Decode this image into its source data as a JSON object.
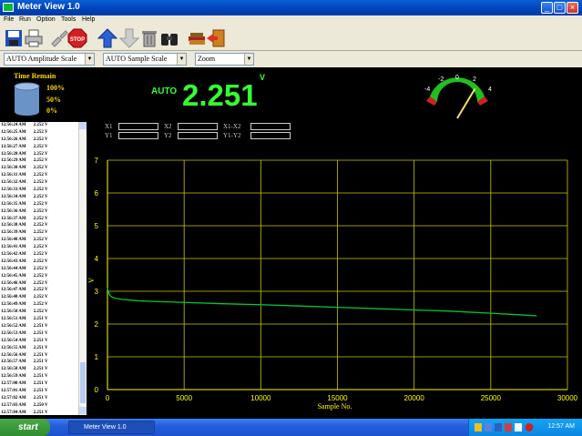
{
  "window": {
    "title": "Meter View 1.0",
    "buttons": {
      "minimize": "_",
      "maximize": "□",
      "close": "×"
    }
  },
  "menu": [
    "File",
    "Run",
    "Option",
    "Tools",
    "Help"
  ],
  "toolbar": {
    "buttons": [
      "save-icon",
      "print-icon",
      "disconnect-icon",
      "stop-icon",
      "arrow-up-icon",
      "arrow-down-icon",
      "trash-icon",
      "binoculars-icon",
      "books-icon",
      "exit-icon"
    ],
    "stop_label": "STOP"
  },
  "options": {
    "amplitude_scale": "AUTO Amplitude Scale",
    "sample_scale": "AUTO Sample Scale",
    "zoom": "Zoom"
  },
  "time_remain": {
    "label": "Time Remain",
    "levels": [
      "100%",
      "50%",
      "0%"
    ]
  },
  "meter": {
    "mode": "AUTO",
    "value": "2.251",
    "unit": "V",
    "gauge_ticks": [
      "-4",
      "-2",
      "0",
      "2",
      "4"
    ],
    "gauge_needle_value": 2.251
  },
  "cursors": {
    "labels": [
      "X1",
      "Y1",
      "X2",
      "Y2",
      "X1-X2",
      "Y1-Y2"
    ]
  },
  "log": [
    [
      "12:56:24 AM",
      "2.252 V"
    ],
    [
      "12:56:25 AM",
      "2.252 V"
    ],
    [
      "12:56:26 AM",
      "2.252 V"
    ],
    [
      "12:56:27 AM",
      "2.252 V"
    ],
    [
      "12:56:28 AM",
      "2.252 V"
    ],
    [
      "12:56:29 AM",
      "2.252 V"
    ],
    [
      "12:56:30 AM",
      "2.252 V"
    ],
    [
      "12:56:31 AM",
      "2.252 V"
    ],
    [
      "12:56:32 AM",
      "2.252 V"
    ],
    [
      "12:56:33 AM",
      "2.252 V"
    ],
    [
      "12:56:34 AM",
      "2.252 V"
    ],
    [
      "12:56:35 AM",
      "2.252 V"
    ],
    [
      "12:56:36 AM",
      "2.252 V"
    ],
    [
      "12:56:37 AM",
      "2.252 V"
    ],
    [
      "12:56:38 AM",
      "2.252 V"
    ],
    [
      "12:56:39 AM",
      "2.252 V"
    ],
    [
      "12:56:40 AM",
      "2.252 V"
    ],
    [
      "12:56:41 AM",
      "2.252 V"
    ],
    [
      "12:56:42 AM",
      "2.252 V"
    ],
    [
      "12:56:43 AM",
      "2.252 V"
    ],
    [
      "12:56:44 AM",
      "2.252 V"
    ],
    [
      "12:56:45 AM",
      "2.252 V"
    ],
    [
      "12:56:46 AM",
      "2.252 V"
    ],
    [
      "12:56:47 AM",
      "2.252 V"
    ],
    [
      "12:56:48 AM",
      "2.252 V"
    ],
    [
      "12:56:49 AM",
      "2.252 V"
    ],
    [
      "12:56:50 AM",
      "2.252 V"
    ],
    [
      "12:56:51 AM",
      "2.251 V"
    ],
    [
      "12:56:52 AM",
      "2.251 V"
    ],
    [
      "12:56:53 AM",
      "2.251 V"
    ],
    [
      "12:56:54 AM",
      "2.251 V"
    ],
    [
      "12:56:55 AM",
      "2.251 V"
    ],
    [
      "12:56:56 AM",
      "2.251 V"
    ],
    [
      "12:56:57 AM",
      "2.251 V"
    ],
    [
      "12:56:58 AM",
      "2.251 V"
    ],
    [
      "12:56:59 AM",
      "2.251 V"
    ],
    [
      "12:57:00 AM",
      "2.251 V"
    ],
    [
      "12:57:01 AM",
      "2.251 V"
    ],
    [
      "12:57:02 AM",
      "2.251 V"
    ],
    [
      "12:57:03 AM",
      "2.250 V"
    ],
    [
      "12:57:04 AM",
      "2.251 V"
    ]
  ],
  "chart_data": {
    "type": "line",
    "xlabel": "Sample No.",
    "ylabel": "V",
    "xlim": [
      0,
      30000
    ],
    "ylim": [
      0,
      7
    ],
    "xticks": [
      0,
      5000,
      10000,
      15000,
      20000,
      25000,
      30000
    ],
    "yticks": [
      0,
      1,
      2,
      3,
      4,
      5,
      6,
      7
    ],
    "grid": true,
    "colors": {
      "line": "#00c832",
      "grid": "#c8c800",
      "axis": "#ffff00"
    },
    "series": [
      {
        "x": [
          0,
          50,
          150,
          300,
          600,
          1000,
          2000,
          3000,
          5000,
          7500,
          10000,
          12500,
          15000,
          17500,
          20000,
          22500,
          25000,
          27000,
          28000
        ],
        "values": [
          3.1,
          3.0,
          2.88,
          2.82,
          2.78,
          2.75,
          2.71,
          2.69,
          2.66,
          2.62,
          2.59,
          2.55,
          2.51,
          2.47,
          2.43,
          2.39,
          2.33,
          2.28,
          2.25
        ]
      }
    ]
  },
  "taskbar": {
    "start": "start",
    "task": "Meter View 1.0",
    "clock": "12:57 AM"
  }
}
